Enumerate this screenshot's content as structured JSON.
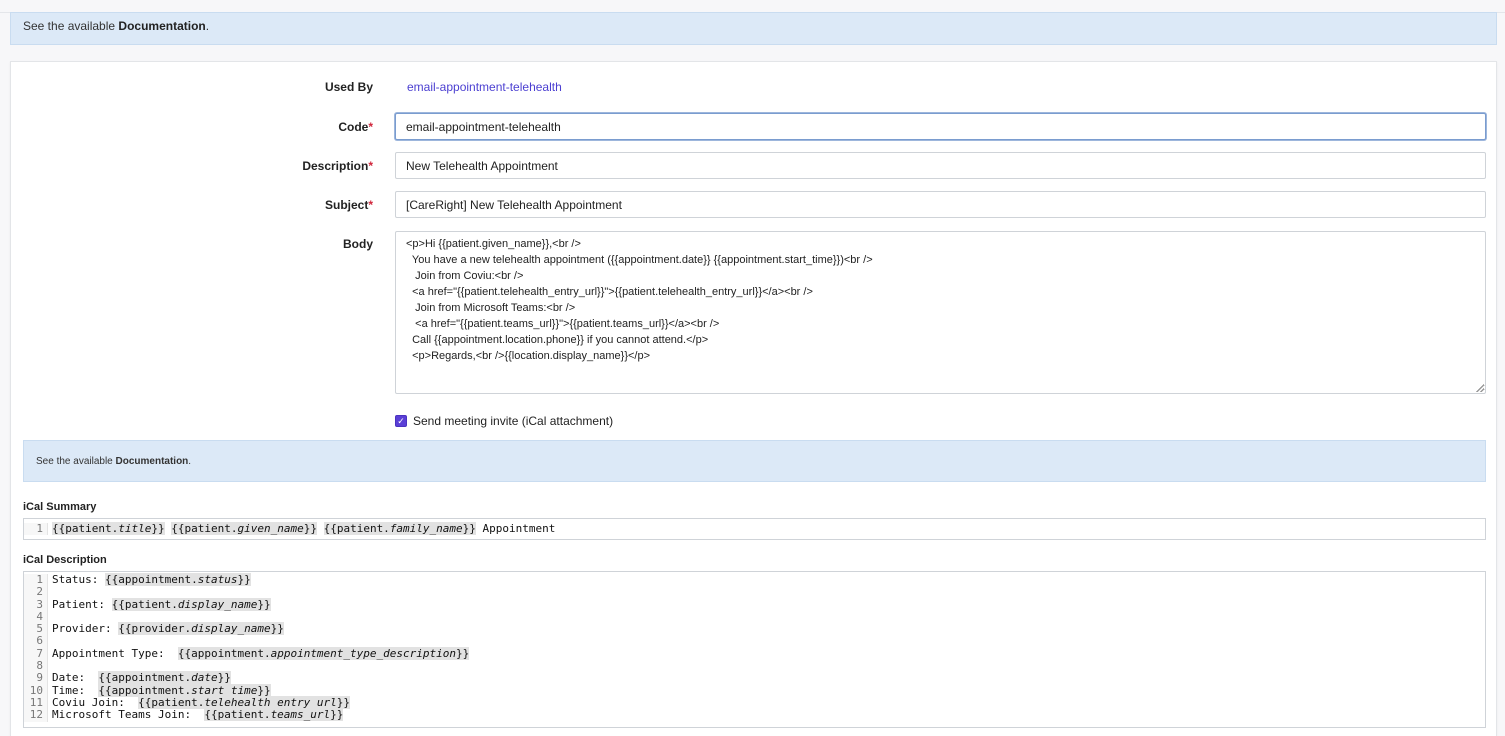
{
  "top_banner": {
    "prefix": "See the available ",
    "link": "Documentation",
    "suffix": "."
  },
  "form": {
    "used_by": {
      "label": "Used By",
      "value": "email-appointment-telehealth"
    },
    "code": {
      "label": "Code",
      "required": "*",
      "value": "email-appointment-telehealth"
    },
    "description": {
      "label": "Description",
      "required": "*",
      "value": "New Telehealth Appointment"
    },
    "subject": {
      "label": "Subject",
      "required": "*",
      "value": "[CareRight] New Telehealth Appointment"
    },
    "body": {
      "label": "Body",
      "value": "<p>Hi {{patient.given_name}},<br />\n  You have a new telehealth appointment ({{appointment.date}} {{appointment.start_time}})<br />\n   Join from Coviu:<br />\n  <a href=\"{{patient.telehealth_entry_url}}\">{{patient.telehealth_entry_url}}</a><br />\n   Join from Microsoft Teams:<br />\n   <a href=\"{{patient.teams_url}}\">{{patient.teams_url}}</a><br />\n  Call {{appointment.location.phone}} if you cannot attend.</p>\n  <p>Regards,<br />{{location.display_name}}</p>"
    },
    "send_invite": {
      "label": "Send meeting invite (iCal attachment)",
      "checked": true
    }
  },
  "doc_box": {
    "prefix": "See the available ",
    "link": "Documentation",
    "suffix": "."
  },
  "ical_summary": {
    "title": "iCal Summary",
    "lines": [
      {
        "n": "1",
        "parts": [
          [
            "tok",
            "patient.",
            "title"
          ],
          [
            "txt",
            " "
          ],
          [
            "tok",
            "patient.",
            "given_name"
          ],
          [
            "txt",
            " "
          ],
          [
            "tok",
            "patient.",
            "family_name"
          ],
          [
            "txt",
            " Appointment"
          ]
        ]
      }
    ]
  },
  "ical_description": {
    "title": "iCal Description",
    "lines": [
      {
        "n": "1",
        "parts": [
          [
            "txt",
            "Status: "
          ],
          [
            "tok",
            "appointment.",
            "status"
          ]
        ]
      },
      {
        "n": "2",
        "parts": []
      },
      {
        "n": "3",
        "parts": [
          [
            "txt",
            "Patient: "
          ],
          [
            "tok",
            "patient.",
            "display_name"
          ]
        ]
      },
      {
        "n": "4",
        "parts": []
      },
      {
        "n": "5",
        "parts": [
          [
            "txt",
            "Provider: "
          ],
          [
            "tok",
            "provider.",
            "display_name"
          ]
        ]
      },
      {
        "n": "6",
        "parts": []
      },
      {
        "n": "7",
        "parts": [
          [
            "txt",
            "Appointment Type:  "
          ],
          [
            "tok",
            "appointment.",
            "appointment_type_description"
          ]
        ]
      },
      {
        "n": "8",
        "parts": []
      },
      {
        "n": "9",
        "parts": [
          [
            "txt",
            "Date:  "
          ],
          [
            "tok",
            "appointment.",
            "date"
          ]
        ]
      },
      {
        "n": "10",
        "parts": [
          [
            "txt",
            "Time:  "
          ],
          [
            "tok",
            "appointment.",
            "start_time"
          ]
        ]
      },
      {
        "n": "11",
        "parts": [
          [
            "txt",
            "Coviu Join:  "
          ],
          [
            "tok",
            "patient.",
            "telehealth_entry_url"
          ]
        ]
      },
      {
        "n": "12",
        "parts": [
          [
            "txt",
            "Microsoft Teams Join:  "
          ],
          [
            "tok",
            "patient.",
            "teams_url"
          ]
        ]
      }
    ]
  },
  "colors": {
    "accent": "#5a3fd6",
    "link": "#4b3fd1",
    "required": "#d0263b",
    "info_bg": "#dce9f7"
  }
}
